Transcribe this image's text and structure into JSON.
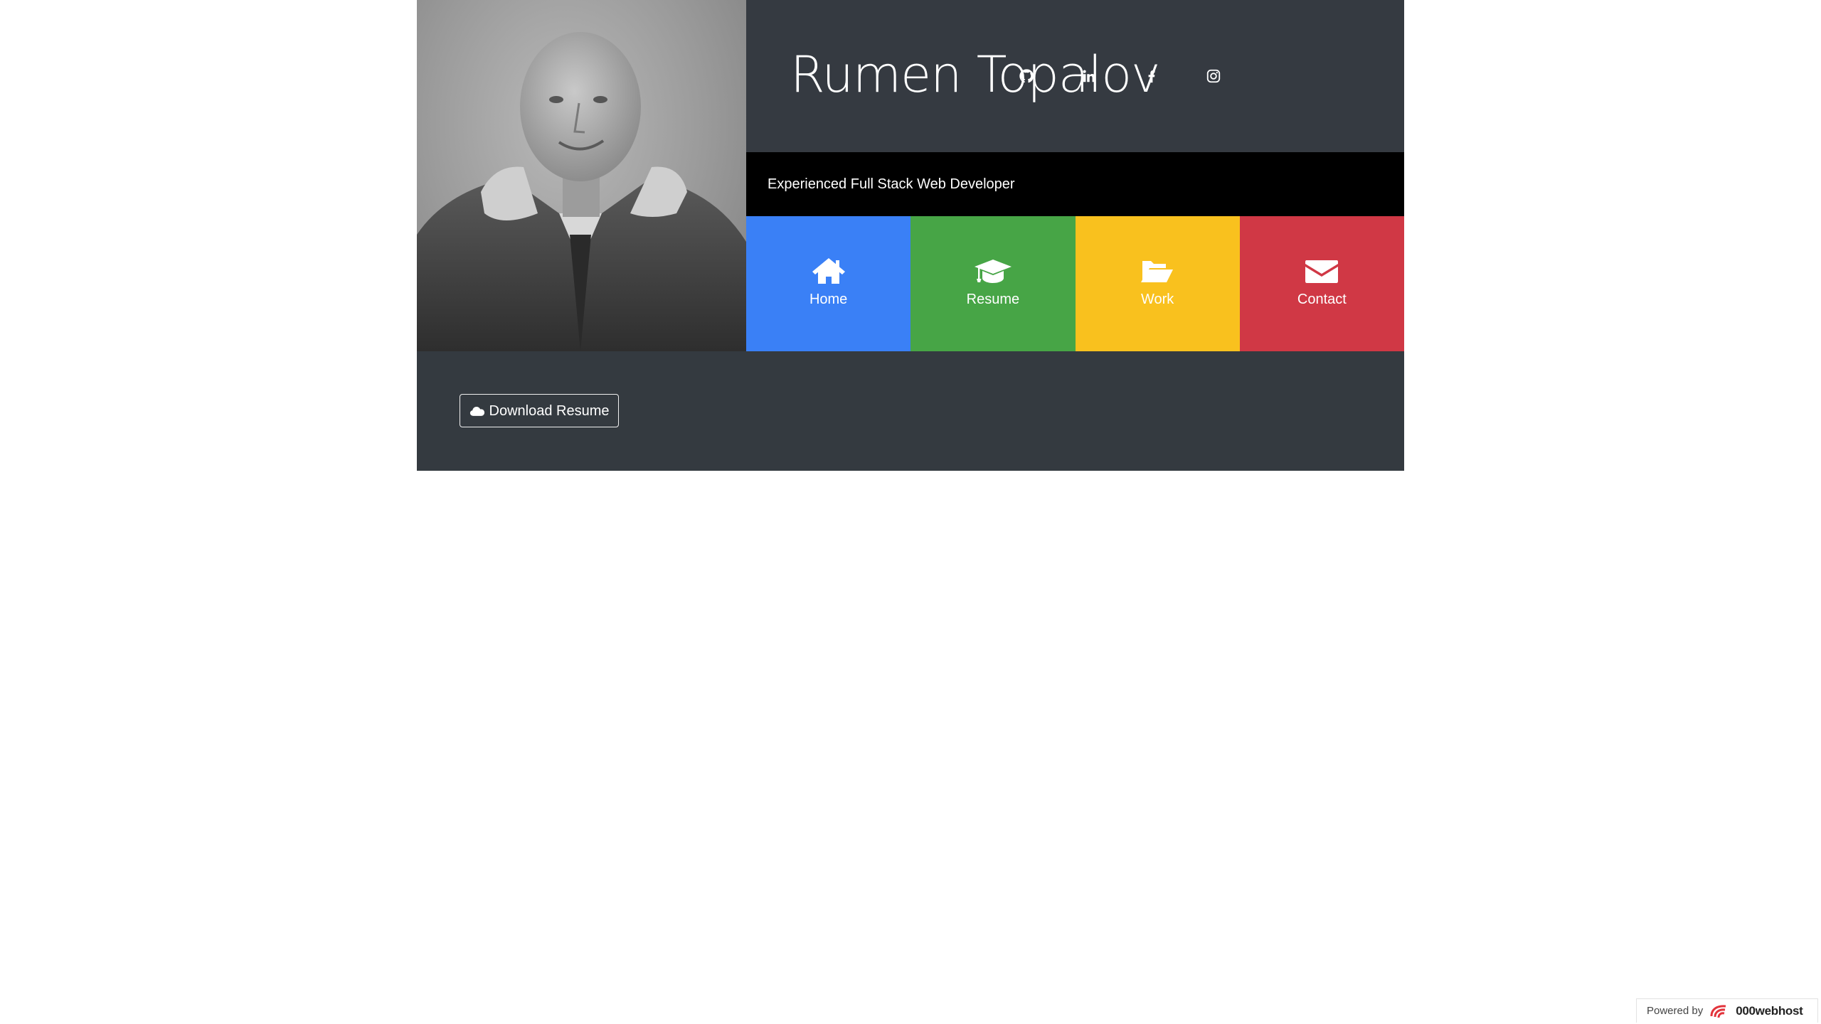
{
  "profile": {
    "name": "Rumen Topalov",
    "tagline": "Experienced Full Stack Web Developer",
    "photo_alt": "Rumen Topalov portrait"
  },
  "social": [
    {
      "name": "github",
      "icon": "github-icon"
    },
    {
      "name": "linkedin",
      "icon": "linkedin-icon"
    },
    {
      "name": "facebook",
      "icon": "facebook-icon"
    },
    {
      "name": "instagram",
      "icon": "instagram-icon"
    }
  ],
  "nav": {
    "tiles": [
      {
        "label": "Home",
        "icon": "home-icon",
        "color": "#3a80f6"
      },
      {
        "label": "Resume",
        "icon": "graduation-cap-icon",
        "color": "#47a546"
      },
      {
        "label": "Work",
        "icon": "folder-open-icon",
        "color": "#f9c11e"
      },
      {
        "label": "Contact",
        "icon": "envelope-icon",
        "color": "#d03845"
      }
    ]
  },
  "actions": {
    "download_label": "Download Resume",
    "download_icon": "cloud-icon"
  },
  "footer": {
    "powered_by": "Powered by",
    "brand": "000webhost"
  },
  "colors": {
    "card_bg": "#343a40",
    "tagline_bg": "#000000",
    "text": "#ffffff"
  }
}
